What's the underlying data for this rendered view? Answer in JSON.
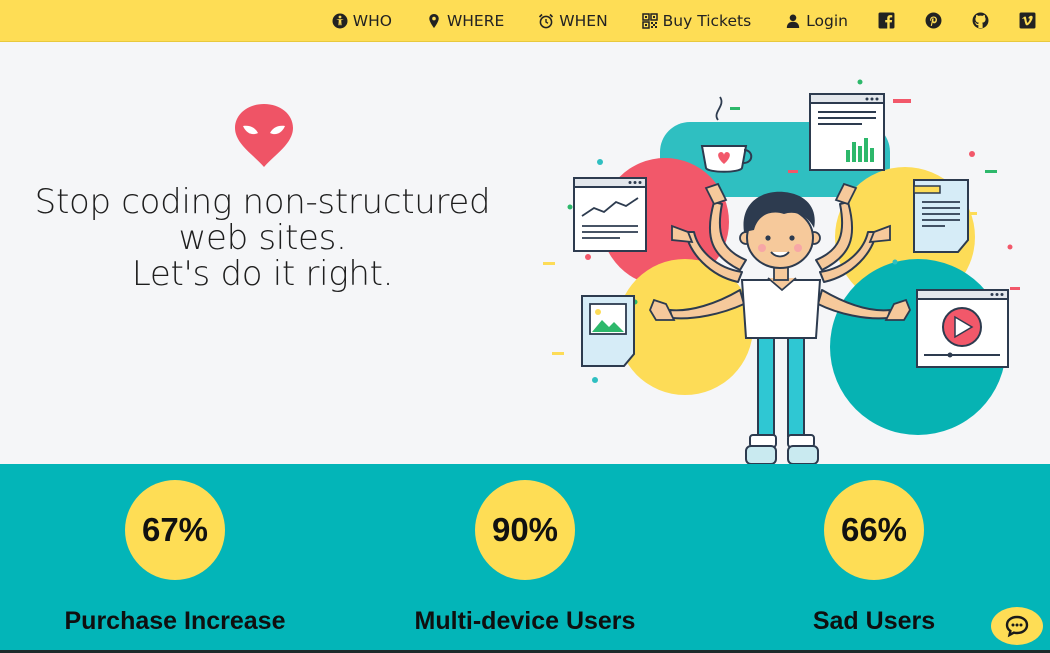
{
  "nav": {
    "who": "WHO",
    "where": "WHERE",
    "when": "WHEN",
    "buy_tickets": "Buy Tickets",
    "login": "Login"
  },
  "social_icons": [
    "facebook-icon",
    "pinterest-icon",
    "github-icon",
    "vimeo-icon"
  ],
  "hero": {
    "line1": "Stop coding non-structured",
    "line2": "web sites.",
    "line3": "Let's do it right."
  },
  "stats": [
    {
      "value": "67%",
      "label": "Purchase Increase"
    },
    {
      "value": "90%",
      "label": "Multi-device Users"
    },
    {
      "value": "66%",
      "label": "Sad Users"
    }
  ],
  "colors": {
    "nav_bg": "#fedd55",
    "stats_bg": "#03b5b8",
    "logo_red": "#ef5466",
    "circle_yellow": "#fedd55"
  }
}
